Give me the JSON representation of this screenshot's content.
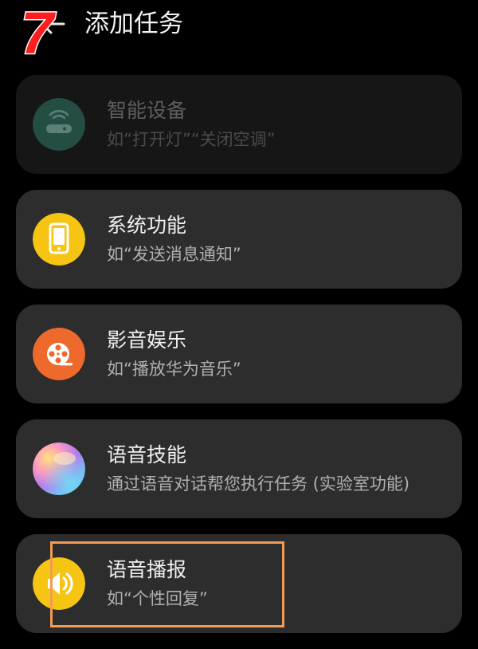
{
  "header": {
    "step_number": "7",
    "back_icon": "back-arrow-icon",
    "title": "添加任务"
  },
  "cards": [
    {
      "title": "智能设备",
      "subtitle": "如“打开灯”“关闭空调”",
      "icon": "router-device-icon",
      "icon_color": "#2f6a5a",
      "state": "disabled"
    },
    {
      "title": "系统功能",
      "subtitle": "如“发送消息通知”",
      "icon": "phone-icon",
      "icon_color": "#f6c514",
      "state": "enabled"
    },
    {
      "title": "影音娱乐",
      "subtitle": "如“播放华为音乐”",
      "icon": "film-reel-icon",
      "icon_color": "#ee6a2c",
      "state": "enabled"
    },
    {
      "title": "语音技能",
      "subtitle": "通过语音对话帮您执行任务 (实验室功能)",
      "icon": "voice-assistant-orb-icon",
      "icon_color": "#d98ad8",
      "state": "enabled"
    },
    {
      "title": "语音播报",
      "subtitle": "如“个性回复”",
      "icon": "speaker-icon",
      "icon_color": "#f6c514",
      "state": "enabled"
    }
  ],
  "annotation": {
    "highlight_color": "#f39a55"
  },
  "colors": {
    "background": "#000000",
    "card_background": "#2d2d2d",
    "card_disabled_background": "#161616",
    "step_badge": "#ff1e1e"
  }
}
